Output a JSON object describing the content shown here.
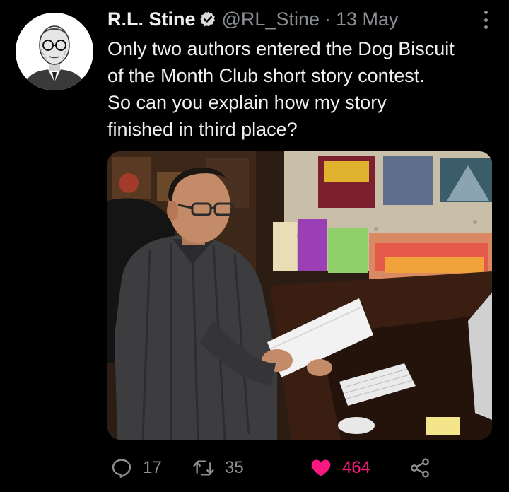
{
  "tweet": {
    "author_name": "R.L. Stine",
    "handle": "@RL_Stine",
    "separator": "·",
    "date": "13 May",
    "text_lines": [
      "Only two authors entered the Dog Biscuit",
      "of the Month Club short story contest.",
      "So can you explain how my story",
      "finished in third place?"
    ]
  },
  "actions": {
    "reply_count": "17",
    "retweet_count": "35",
    "like_count": "464"
  },
  "colors": {
    "background": "#000000",
    "text": "#f0f0f0",
    "muted": "#8b8f94",
    "like": "#f91880"
  },
  "icons": [
    "verified-badge-icon",
    "more-options-icon",
    "reply-icon",
    "retweet-icon",
    "like-heart-icon",
    "share-icon"
  ]
}
